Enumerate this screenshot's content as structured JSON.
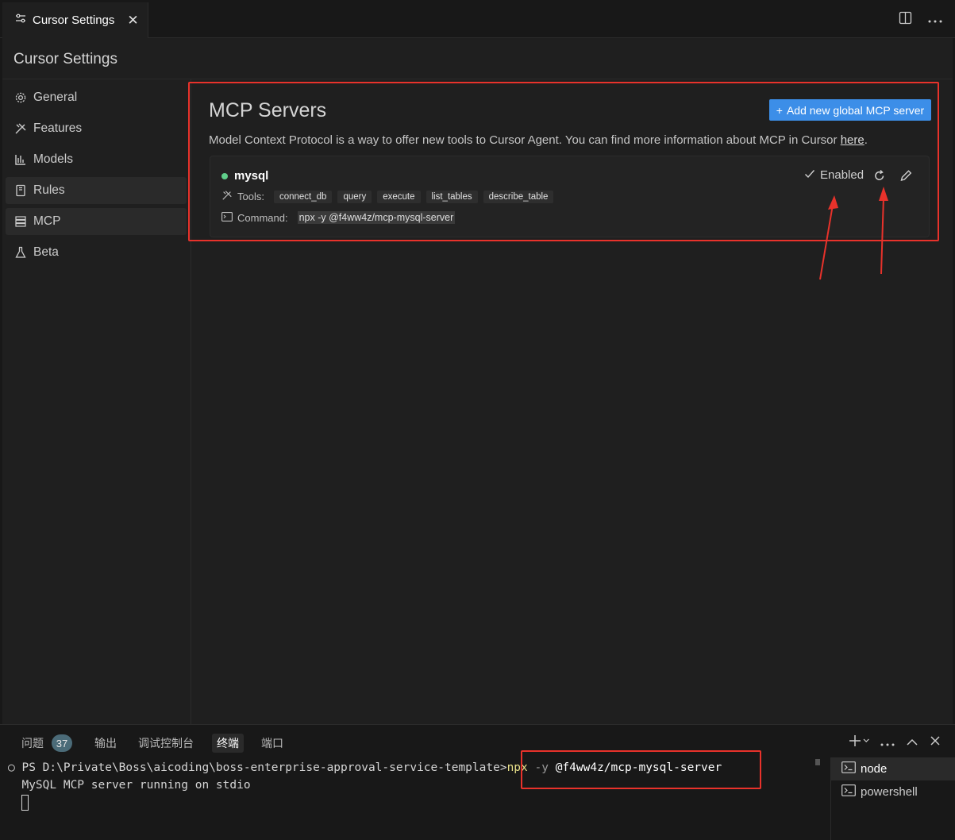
{
  "tab": {
    "title": "Cursor Settings"
  },
  "header": {
    "title": "Cursor Settings"
  },
  "sidebar": {
    "items": [
      {
        "label": "General",
        "icon": "gear-icon"
      },
      {
        "label": "Features",
        "icon": "tools-icon"
      },
      {
        "label": "Models",
        "icon": "bar-chart-icon"
      },
      {
        "label": "Rules",
        "icon": "book-icon"
      },
      {
        "label": "MCP",
        "icon": "server-icon"
      },
      {
        "label": "Beta",
        "icon": "flask-icon"
      }
    ]
  },
  "mcp": {
    "title": "MCP Servers",
    "add_button": "Add new global MCP server",
    "description": "Model Context Protocol is a way to offer new tools to Cursor Agent. You can find more information about MCP in Cursor ",
    "link": "here",
    "link_suffix": ".",
    "server": {
      "name": "mysql",
      "status": "Enabled",
      "status_color": "#5fcf8a",
      "tools_label": "Tools:",
      "tools": [
        "connect_db",
        "query",
        "execute",
        "list_tables",
        "describe_table"
      ],
      "command_label": "Command:",
      "command": "npx -y @f4ww4z/mcp-mysql-server"
    }
  },
  "panel": {
    "tabs": [
      {
        "label": "问题",
        "badge": "37"
      },
      {
        "label": "输出"
      },
      {
        "label": "调试控制台"
      },
      {
        "label": "终端"
      },
      {
        "label": "端口"
      }
    ],
    "terminal": {
      "prompt": "PS D:\\Private\\Boss\\aicoding\\boss-enterprise-approval-service-template>",
      "cmd_npx": "npx",
      "cmd_flag": "-y",
      "cmd_pkg": "@f4ww4z/mcp-mysql-server",
      "output": "MySQL MCP server running on stdio"
    },
    "terminals": [
      {
        "label": "node"
      },
      {
        "label": "powershell"
      }
    ]
  },
  "colors": {
    "accent": "#3c8ee8",
    "annotation": "#e8322b"
  }
}
